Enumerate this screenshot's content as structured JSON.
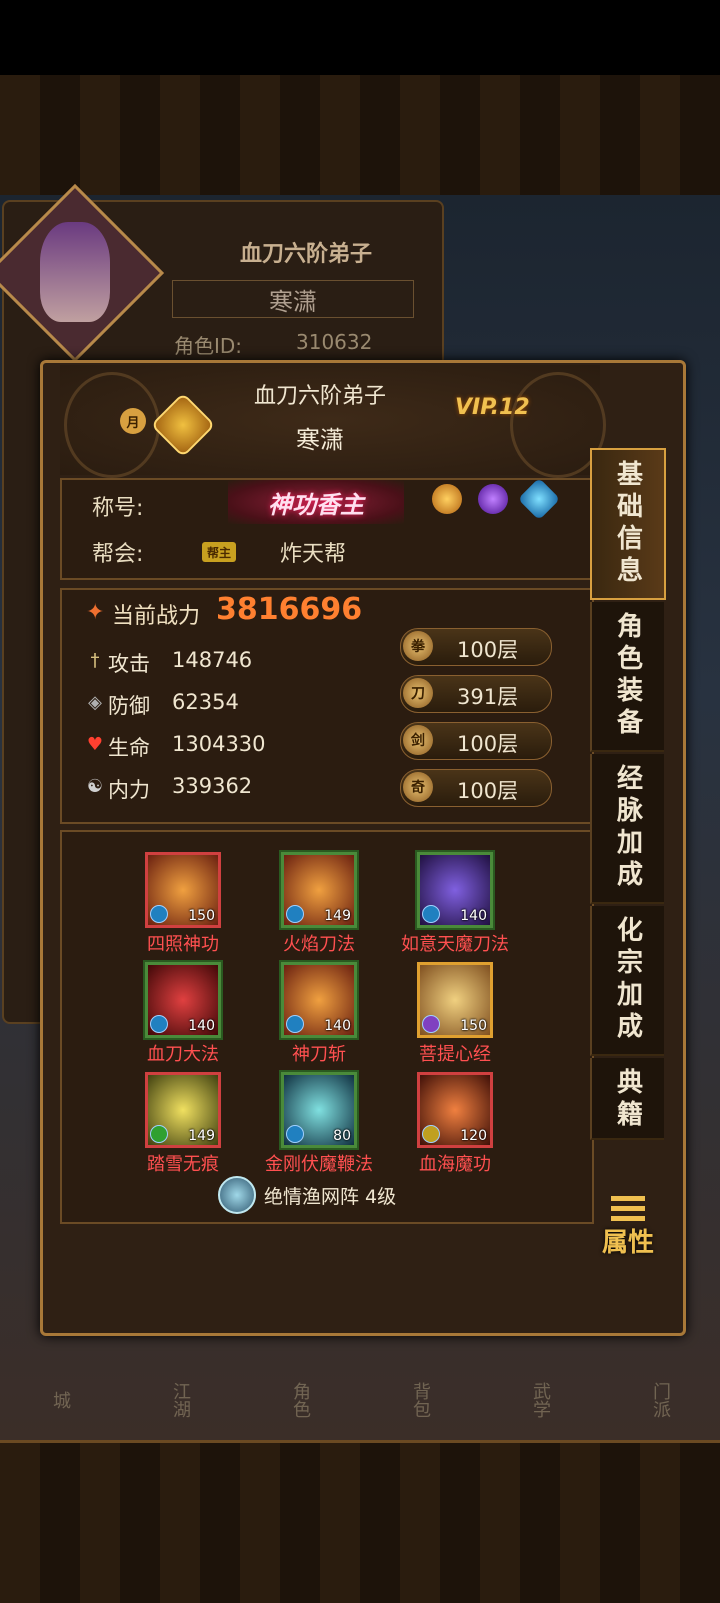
{
  "back_panel": {
    "title": "血刀六阶弟子",
    "name": "寒潇",
    "id_label": "角色ID:",
    "id_value": "310632"
  },
  "header": {
    "month_badge": "月",
    "title": "血刀六阶弟子",
    "name": "寒潇",
    "vip": "VIP.12"
  },
  "info": {
    "title_label": "称号:",
    "title_badge": "神功香主",
    "guild_label": "帮会:",
    "guild_role": "帮主",
    "guild_name": "炸天帮"
  },
  "stats": {
    "power_label": "当前战力",
    "power_value": "3816696",
    "attack_label": "攻击",
    "attack_value": "148746",
    "defense_label": "防御",
    "defense_value": "62354",
    "hp_label": "生命",
    "hp_value": "1304330",
    "mp_label": "内力",
    "mp_value": "339362"
  },
  "layers": [
    {
      "icon": "拳",
      "value": "100层"
    },
    {
      "icon": "刀",
      "value": "391层"
    },
    {
      "icon": "剑",
      "value": "100层"
    },
    {
      "icon": "奇",
      "value": "100层"
    }
  ],
  "skills": [
    {
      "name": "四照神功",
      "level": "150"
    },
    {
      "name": "火焰刀法",
      "level": "149"
    },
    {
      "name": "如意天魔刀法",
      "level": "140"
    },
    {
      "name": "血刀大法",
      "level": "140"
    },
    {
      "name": "神刀斩",
      "level": "140"
    },
    {
      "name": "菩提心经",
      "level": "150"
    },
    {
      "name": "踏雪无痕",
      "level": "149"
    },
    {
      "name": "金刚伏魔鞭法",
      "level": "80"
    },
    {
      "name": "血海魔功",
      "level": "120"
    }
  ],
  "formation": "绝情渔网阵 4级",
  "side_tabs": [
    "基础信息",
    "角色装备",
    "经脉加成",
    "化宗加成",
    "典籍"
  ],
  "attr_button": "属性",
  "bottom_nav": [
    "城",
    "江湖",
    "角色",
    "背包",
    "武学",
    "门派"
  ]
}
